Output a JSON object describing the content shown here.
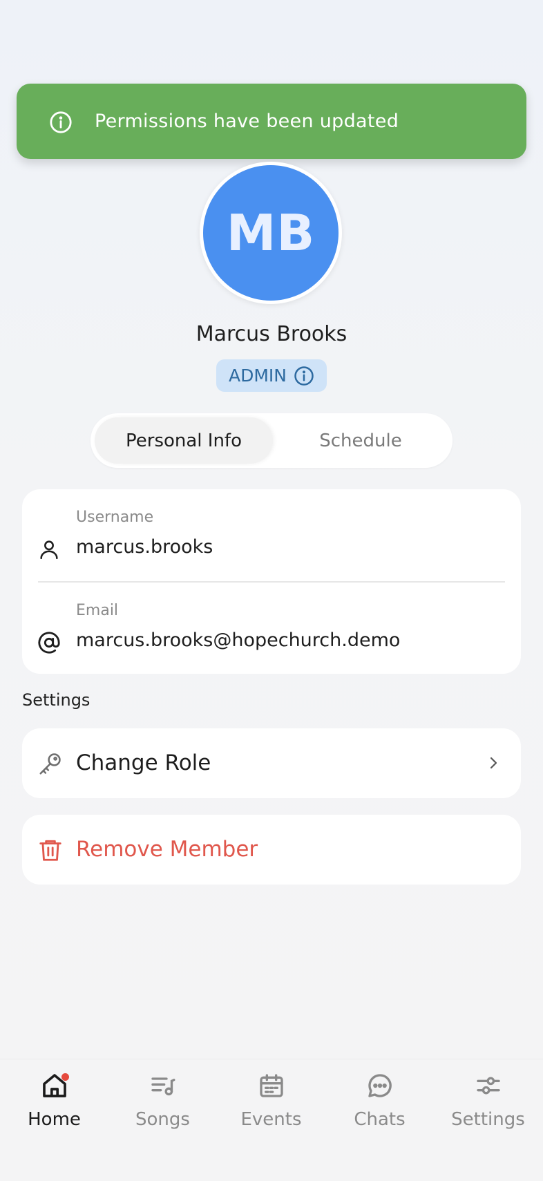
{
  "toast": {
    "message": "Permissions have been updated",
    "icon": "info-icon",
    "color": "#68ae5a"
  },
  "profile": {
    "initials": "MB",
    "name": "Marcus Brooks",
    "role": "ADMIN",
    "avatar_color": "#4a90f0"
  },
  "tabs": [
    {
      "label": "Personal Info",
      "active": true
    },
    {
      "label": "Schedule",
      "active": false
    }
  ],
  "fields": {
    "username_label": "Username",
    "username_value": "marcus.brooks",
    "email_label": "Email",
    "email_value": "marcus.brooks@hopechurch.demo"
  },
  "settings": {
    "title": "Settings",
    "change_role": "Change Role",
    "remove_member": "Remove Member",
    "danger_color": "#e0574c"
  },
  "nav": [
    {
      "label": "Home",
      "icon": "home-icon",
      "active": true,
      "has_dot": true
    },
    {
      "label": "Songs",
      "icon": "songs-icon",
      "active": false
    },
    {
      "label": "Events",
      "icon": "calendar-icon",
      "active": false
    },
    {
      "label": "Chats",
      "icon": "chat-icon",
      "active": false
    },
    {
      "label": "Settings",
      "icon": "sliders-icon",
      "active": false
    }
  ]
}
